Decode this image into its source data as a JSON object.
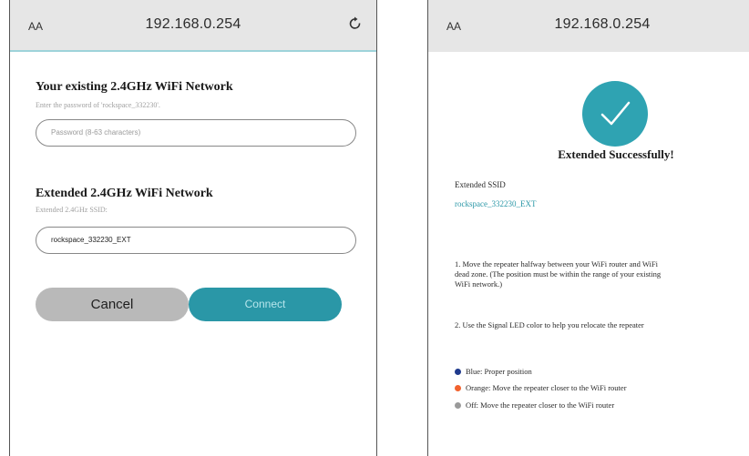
{
  "left": {
    "address_bar": {
      "aa": "AA",
      "url": "192.168.0.254"
    },
    "existing": {
      "title": "Your existing 2.4GHz WiFi Network",
      "hint": "Enter the password of 'rockspace_332230'.",
      "password_placeholder": "Password (8-63 characters)"
    },
    "extended": {
      "title": "Extended 2.4GHz WiFi Network",
      "hint": "Extended 2.4GHz SSID:",
      "ssid_value": "rockspace_332230_EXT"
    },
    "buttons": {
      "cancel": "Cancel",
      "connect": "Connect"
    }
  },
  "right": {
    "address_bar": {
      "aa": "AA",
      "url": "192.168.0.254"
    },
    "success_title": "Extended Successfully!",
    "ssid_label": "Extended SSID",
    "ssid_value": "rockspace_332230_EXT",
    "step1_lines": [
      "1. Move the repeater halfway between your WiFi router and WiFi",
      "dead zone. (The position must be within the range of your existing",
      "WiFi network.)"
    ],
    "step2": "2. Use the Signal LED color to help you relocate the repeater",
    "led_states": [
      {
        "color": "#1f3a8c",
        "text": "Blue: Proper position"
      },
      {
        "color": "#f2622e",
        "text": "Orange: Move the repeater closer to the WiFi router"
      },
      {
        "color": "#9a9a9a",
        "text": "Off: Move the repeater closer to the WiFi router"
      }
    ]
  }
}
